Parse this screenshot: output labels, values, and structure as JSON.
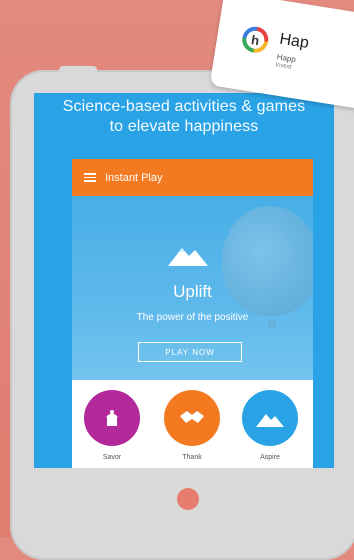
{
  "headline": {
    "line1": "Science-based activities & games",
    "line2": "to elevate happiness"
  },
  "topbar": {
    "label": "Instant Play"
  },
  "hero": {
    "title": "Uplift",
    "subtitle": "The power of the positive",
    "play_label": "PLAY NOW"
  },
  "categories": [
    {
      "label": "Savor",
      "color": "#b3289a",
      "icon": "cupcake-icon"
    },
    {
      "label": "Thank",
      "color": "#f47a22",
      "icon": "handshake-icon"
    },
    {
      "label": "Aspire",
      "color": "#2aa3e6",
      "icon": "mountain-icon"
    }
  ],
  "badge": {
    "logo_letter": "h",
    "title": "Hap",
    "sub1": "Happ",
    "sub2": "Invest"
  },
  "colors": {
    "background": "#e07c70",
    "screen_blue": "#2aa3e6",
    "topbar_orange": "#f47a22",
    "tablet_gray": "#d9d9d9"
  }
}
